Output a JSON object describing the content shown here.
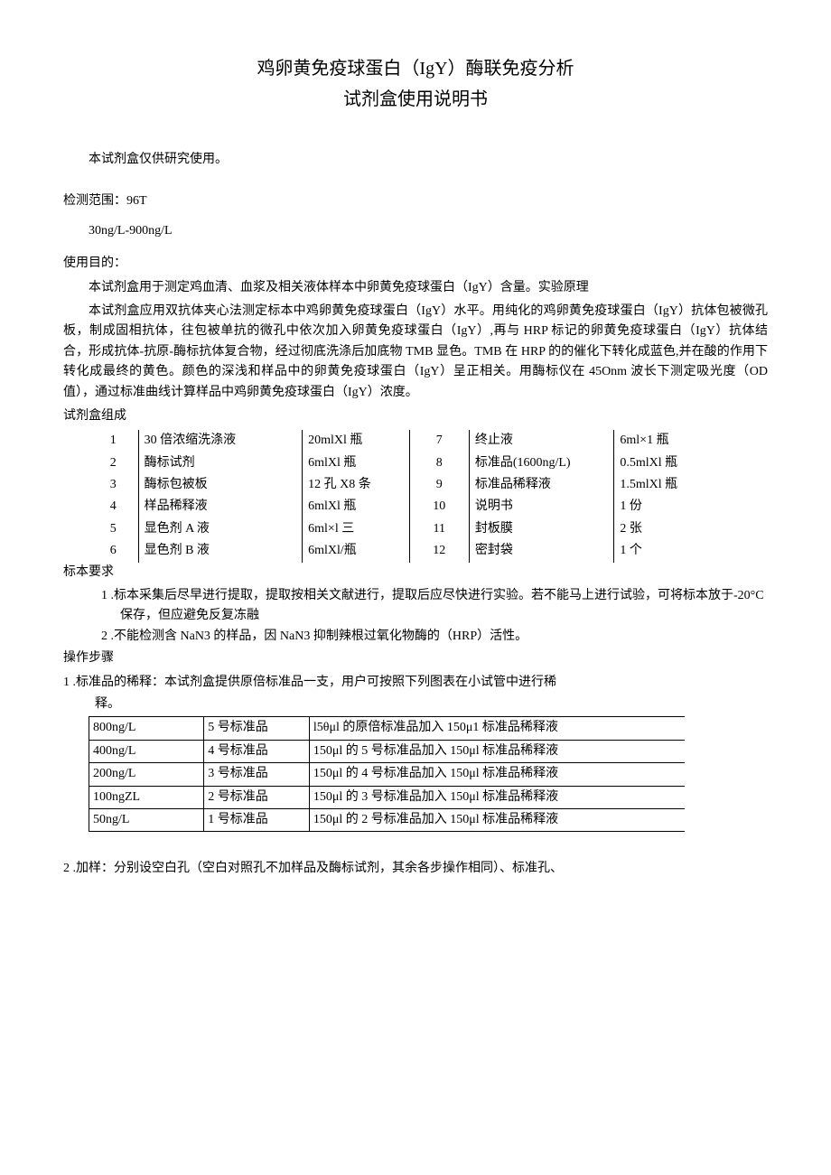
{
  "title_line1": "鸡卵黄免疫球蛋白（IgY）酶联免疫分析",
  "title_line2": "试剂盒使用说明书",
  "research_only": "本试剂盒仅供研究使用。",
  "detect_label": "检测范围：96T",
  "detect_range": "30ng/L-900ng/L",
  "purpose_label": "使用目的：",
  "purpose_body": "本试剂盒用于测定鸡血清、血浆及相关液体样本中卵黄免疫球蛋白（IgY）含量。实验原理",
  "principle_body": "本试剂盒应用双抗体夹心法测定标本中鸡卵黄免疫球蛋白（IgY）水平。用纯化的鸡卵黄免疫球蛋白（IgY）抗体包被微孔板，制成固相抗体，往包被单抗的微孔中依次加入卵黄免疫球蛋白（IgY）,再与 HRP 标记的卵黄免疫球蛋白（IgY）抗体结合，形成抗体-抗原-酶标抗体复合物，经过彻底洗涤后加底物 TMB 显色。TMB 在 HRP 的的催化下转化成蓝色,并在酸的作用下转化成最终的黄色。颜色的深浅和样品中的卵黄免疫球蛋白（IgY）呈正相关。用酶标仪在 45Onm 波长下测定吸光度（OD 值），通过标准曲线计算样品中鸡卵黄免疫球蛋白（IgY）浓度。",
  "composition_label": "试剂盒组成",
  "composition": [
    {
      "n1": "1",
      "name1": "30 倍浓缩洗涤液",
      "q1": "20mlXl 瓶",
      "n2": "7",
      "name2": "终止液",
      "q2": "6ml×1 瓶"
    },
    {
      "n1": "2",
      "name1": "酶标试剂",
      "q1": "6mlXl 瓶",
      "n2": "8",
      "name2": "标准品(1600ng/L)",
      "q2": "0.5mlXl 瓶"
    },
    {
      "n1": "3",
      "name1": "酶标包被板",
      "q1": "12 孔 X8 条",
      "n2": "9",
      "name2": "标准品稀释液",
      "q2": "1.5mlXl 瓶"
    },
    {
      "n1": "4",
      "name1": "样品稀释液",
      "q1": "6mlXl 瓶",
      "n2": "10",
      "name2": "说明书",
      "q2": "1 份"
    },
    {
      "n1": "5",
      "name1": "显色剂 A 液",
      "q1": "6ml×l 三",
      "n2": "11",
      "name2": "封板膜",
      "q2": "2 张"
    },
    {
      "n1": "6",
      "name1": "显色剂 B 液",
      "q1": "6mlXl/瓶",
      "n2": "12",
      "name2": "密封袋",
      "q2": "1 个"
    }
  ],
  "spec_label": "标本要求",
  "spec_items": [
    "1 .标本采集后尽早进行提取，提取按相关文献进行，提取后应尽快进行实验。若不能马上进行试验，可将标本放于-20°C 保存，但应避免反复冻融",
    "2 .不能检测含 NaN3 的样品，因 NaN3 抑制辣根过氧化物酶的（HRP）活性。"
  ],
  "ops_label": "操作步骤",
  "step1_a": "1 .标准品的稀释：本试剂盒提供原倍标准品一支，用户可按照下列图表在小试管中进行稀",
  "step1_b": "释。",
  "dilution": [
    {
      "c": "800ng/L",
      "s": "5 号标准品",
      "d": "l5θμl 的原倍标准品加入 150μ1 标准品稀释液"
    },
    {
      "c": "400ng/L",
      "s": "4 号标准品",
      "d": "150μl 的 5 号标准品加入 150μl 标准品稀释液"
    },
    {
      "c": "200ng/L",
      "s": "3 号标准品",
      "d": "150μl 的 4 号标准品加入 150μl 标准品稀释液"
    },
    {
      "c": "100ngZL",
      "s": "2 号标准品",
      "d": "150μl 的 3 号标准品加入 150μl 标准品稀释液"
    },
    {
      "c": "50ng/L",
      "s": "1 号标准品",
      "d": "150μl 的 2 号标准品加入 150μl 标准品稀释液"
    }
  ],
  "step2": "2 .加样：分别设空白孔（空白对照孔不加样品及酶标试剂，其余各步操作相同）、标准孔、"
}
